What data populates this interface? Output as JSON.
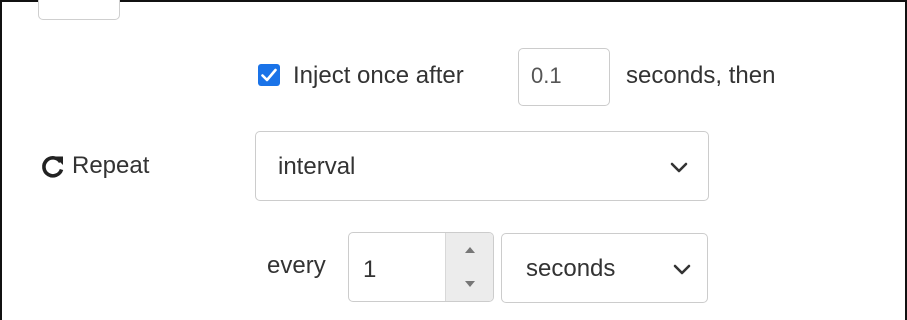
{
  "inject_once": {
    "checked": true,
    "label": "Inject once after",
    "delay_value": "0.1",
    "suffix": "seconds, then"
  },
  "repeat": {
    "label": "Repeat",
    "icon": "redo-icon",
    "mode_value": "interval"
  },
  "interval": {
    "label": "every",
    "amount": "1",
    "unit_value": "seconds"
  },
  "colors": {
    "checkbox_accent": "#1a73e8",
    "text": "#333333",
    "border": "#cccccc"
  }
}
